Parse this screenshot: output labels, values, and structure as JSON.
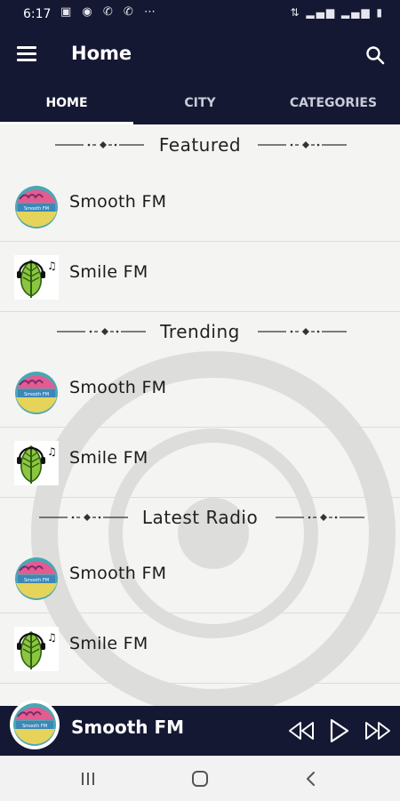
{
  "status_bar": {
    "time": "6:17",
    "left_icons": [
      "image-icon",
      "messenger-icon",
      "whatsapp-icon",
      "whatsapp-icon",
      "more-icon"
    ],
    "right_icons": [
      "volte-icon",
      "signal-icon",
      "signal-icon",
      "battery-icon"
    ]
  },
  "app_bar": {
    "title": "Home",
    "menu_icon": "hamburger-menu-icon",
    "search_icon": "search-icon"
  },
  "tabs": [
    {
      "label": "HOME",
      "active": true
    },
    {
      "label": "CITY",
      "active": false
    },
    {
      "label": "CATEGORIES",
      "active": false
    }
  ],
  "sections": [
    {
      "title": "Featured",
      "stations": [
        {
          "name": "Smooth FM",
          "logo": "smooth-fm-logo"
        },
        {
          "name": "Smile FM",
          "logo": "smile-fm-logo"
        }
      ]
    },
    {
      "title": "Trending",
      "stations": [
        {
          "name": "Smooth FM",
          "logo": "smooth-fm-logo"
        },
        {
          "name": "Smile FM",
          "logo": "smile-fm-logo"
        }
      ]
    },
    {
      "title": "Latest Radio",
      "stations": [
        {
          "name": "Smooth FM",
          "logo": "smooth-fm-logo"
        },
        {
          "name": "Smile FM",
          "logo": "smile-fm-logo"
        }
      ]
    }
  ],
  "player": {
    "station_name": "Smooth FM",
    "logo_text": "Smooth FM",
    "controls": [
      "rewind-icon",
      "play-icon",
      "fast-forward-icon"
    ]
  },
  "nav_bar": {
    "buttons": [
      "recent-apps-icon",
      "home-icon",
      "back-icon"
    ]
  },
  "colors": {
    "primary_dark": "#151833",
    "background": "#f4f4f2",
    "divider": "#dcdcdc",
    "text": "#1a1a1a"
  }
}
